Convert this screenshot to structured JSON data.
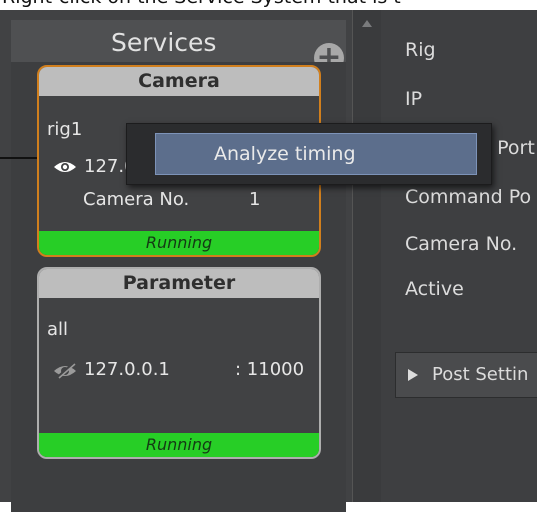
{
  "instruction_banner": "Right-click on the Service System that is t",
  "services": {
    "title": "Services",
    "add_icon": "plus-circle-icon"
  },
  "cards": [
    {
      "title": "Camera",
      "name": "rig1",
      "ip": "127.0.0.1",
      "camera_no_label": "Camera No.",
      "camera_no": "1",
      "status": "Running",
      "visibility_icon": "eye-icon"
    },
    {
      "title": "Parameter",
      "name": "all",
      "ip": "127.0.0.1",
      "port": ": 11000",
      "status": "Running",
      "visibility_icon": "eye-off-icon"
    }
  ],
  "context_menu": {
    "items": [
      "Analyze timing"
    ]
  },
  "properties": {
    "rig": "Rig",
    "ip": "IP",
    "port_partial": "g Port",
    "command_port": "Command Po",
    "camera_no": "Camera No.",
    "active": "Active",
    "post_settings": "Post Settin"
  },
  "colors": {
    "selected_border": "#d17f1d",
    "running": "#27ce26",
    "menu_highlight": "#5c6e8c"
  }
}
